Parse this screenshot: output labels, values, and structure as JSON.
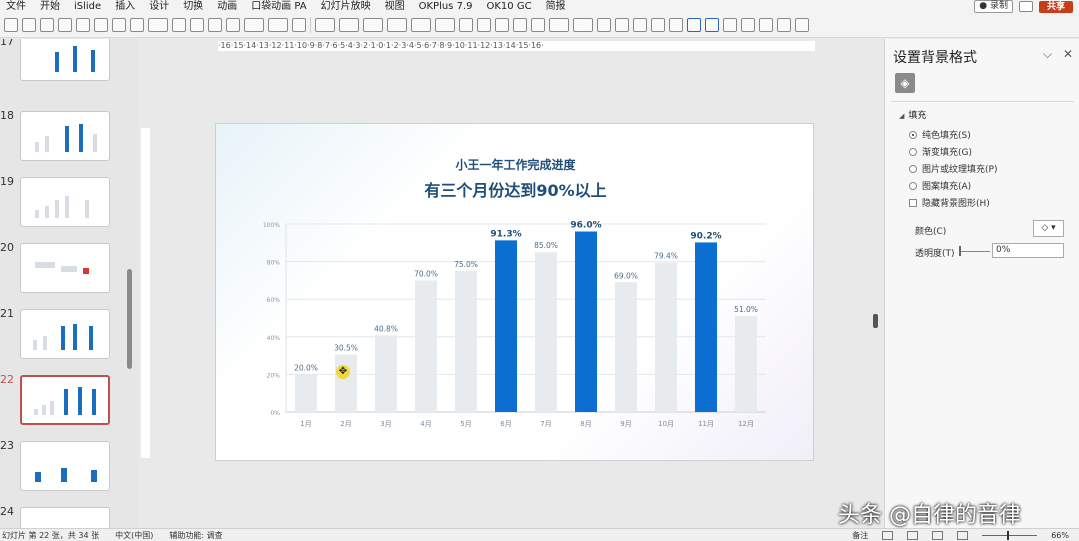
{
  "menu": {
    "items": [
      "文件",
      "开始",
      "iSlide",
      "插入",
      "设计",
      "切换",
      "动画",
      "口袋动画 PA",
      "幻灯片放映",
      "视图",
      "OKPlus 7.9",
      "OK10 GC",
      "简报"
    ],
    "record_label": "● 录制",
    "share_label": "共享"
  },
  "thumbnails": [
    {
      "num": "17"
    },
    {
      "num": "18"
    },
    {
      "num": "19"
    },
    {
      "num": "20"
    },
    {
      "num": "21"
    },
    {
      "num": "22"
    },
    {
      "num": "23"
    },
    {
      "num": "24"
    }
  ],
  "ruler_text": "·16·15·14·13·12·11·10·9·8·7·6·5·4·3·2·1·0·1·2·3·4·5·6·7·8·9·10·11·12·13·14·15·16·",
  "slide": {
    "subtitle": "小王一年工作完成进度",
    "title": "有三个月份达到90%以上"
  },
  "chart_data": {
    "type": "bar",
    "categories": [
      "1月",
      "2月",
      "3月",
      "4月",
      "5月",
      "6月",
      "7月",
      "8月",
      "9月",
      "10月",
      "11月",
      "12月"
    ],
    "values": [
      20.0,
      30.5,
      40.8,
      70.0,
      75.0,
      91.3,
      85.0,
      96.0,
      69.0,
      79.4,
      90.2,
      51.0
    ],
    "data_labels": [
      "20.0%",
      "30.5%",
      "40.8%",
      "70.0%",
      "75.0%",
      "91.3%",
      "85.0%",
      "96.0%",
      "69.0%",
      "79.4%",
      "90.2%",
      "51.0%"
    ],
    "highlight": [
      false,
      false,
      false,
      false,
      false,
      true,
      false,
      true,
      false,
      false,
      true,
      false
    ],
    "yticks": [
      "0%",
      "20%",
      "40%",
      "60%",
      "80%",
      "100%"
    ],
    "ylim": [
      0,
      100
    ],
    "grid": true,
    "colors": {
      "normal": "#e8ebee",
      "highlight": "#0a6fd0",
      "label": "#4a6b8a",
      "label_highlight": "#1f4e79"
    }
  },
  "pane": {
    "title": "设置背景格式",
    "section": "填充",
    "options": [
      "纯色填充(S)",
      "渐变填充(G)",
      "图片或纹理填充(P)",
      "图案填充(A)"
    ],
    "selected": 0,
    "hide_bg_label": "隐藏背景图形(H)",
    "color_label": "颜色(C)",
    "transparency_label": "透明度(T)",
    "transparency_value": "0%"
  },
  "status": {
    "slide_info": "幻灯片 第 22 张，共 34 张",
    "language": "中文(中国)",
    "accessibility": "辅助功能: 调查",
    "notes": "备注",
    "zoom": "66%"
  },
  "watermark": "头条 @自律的音律"
}
